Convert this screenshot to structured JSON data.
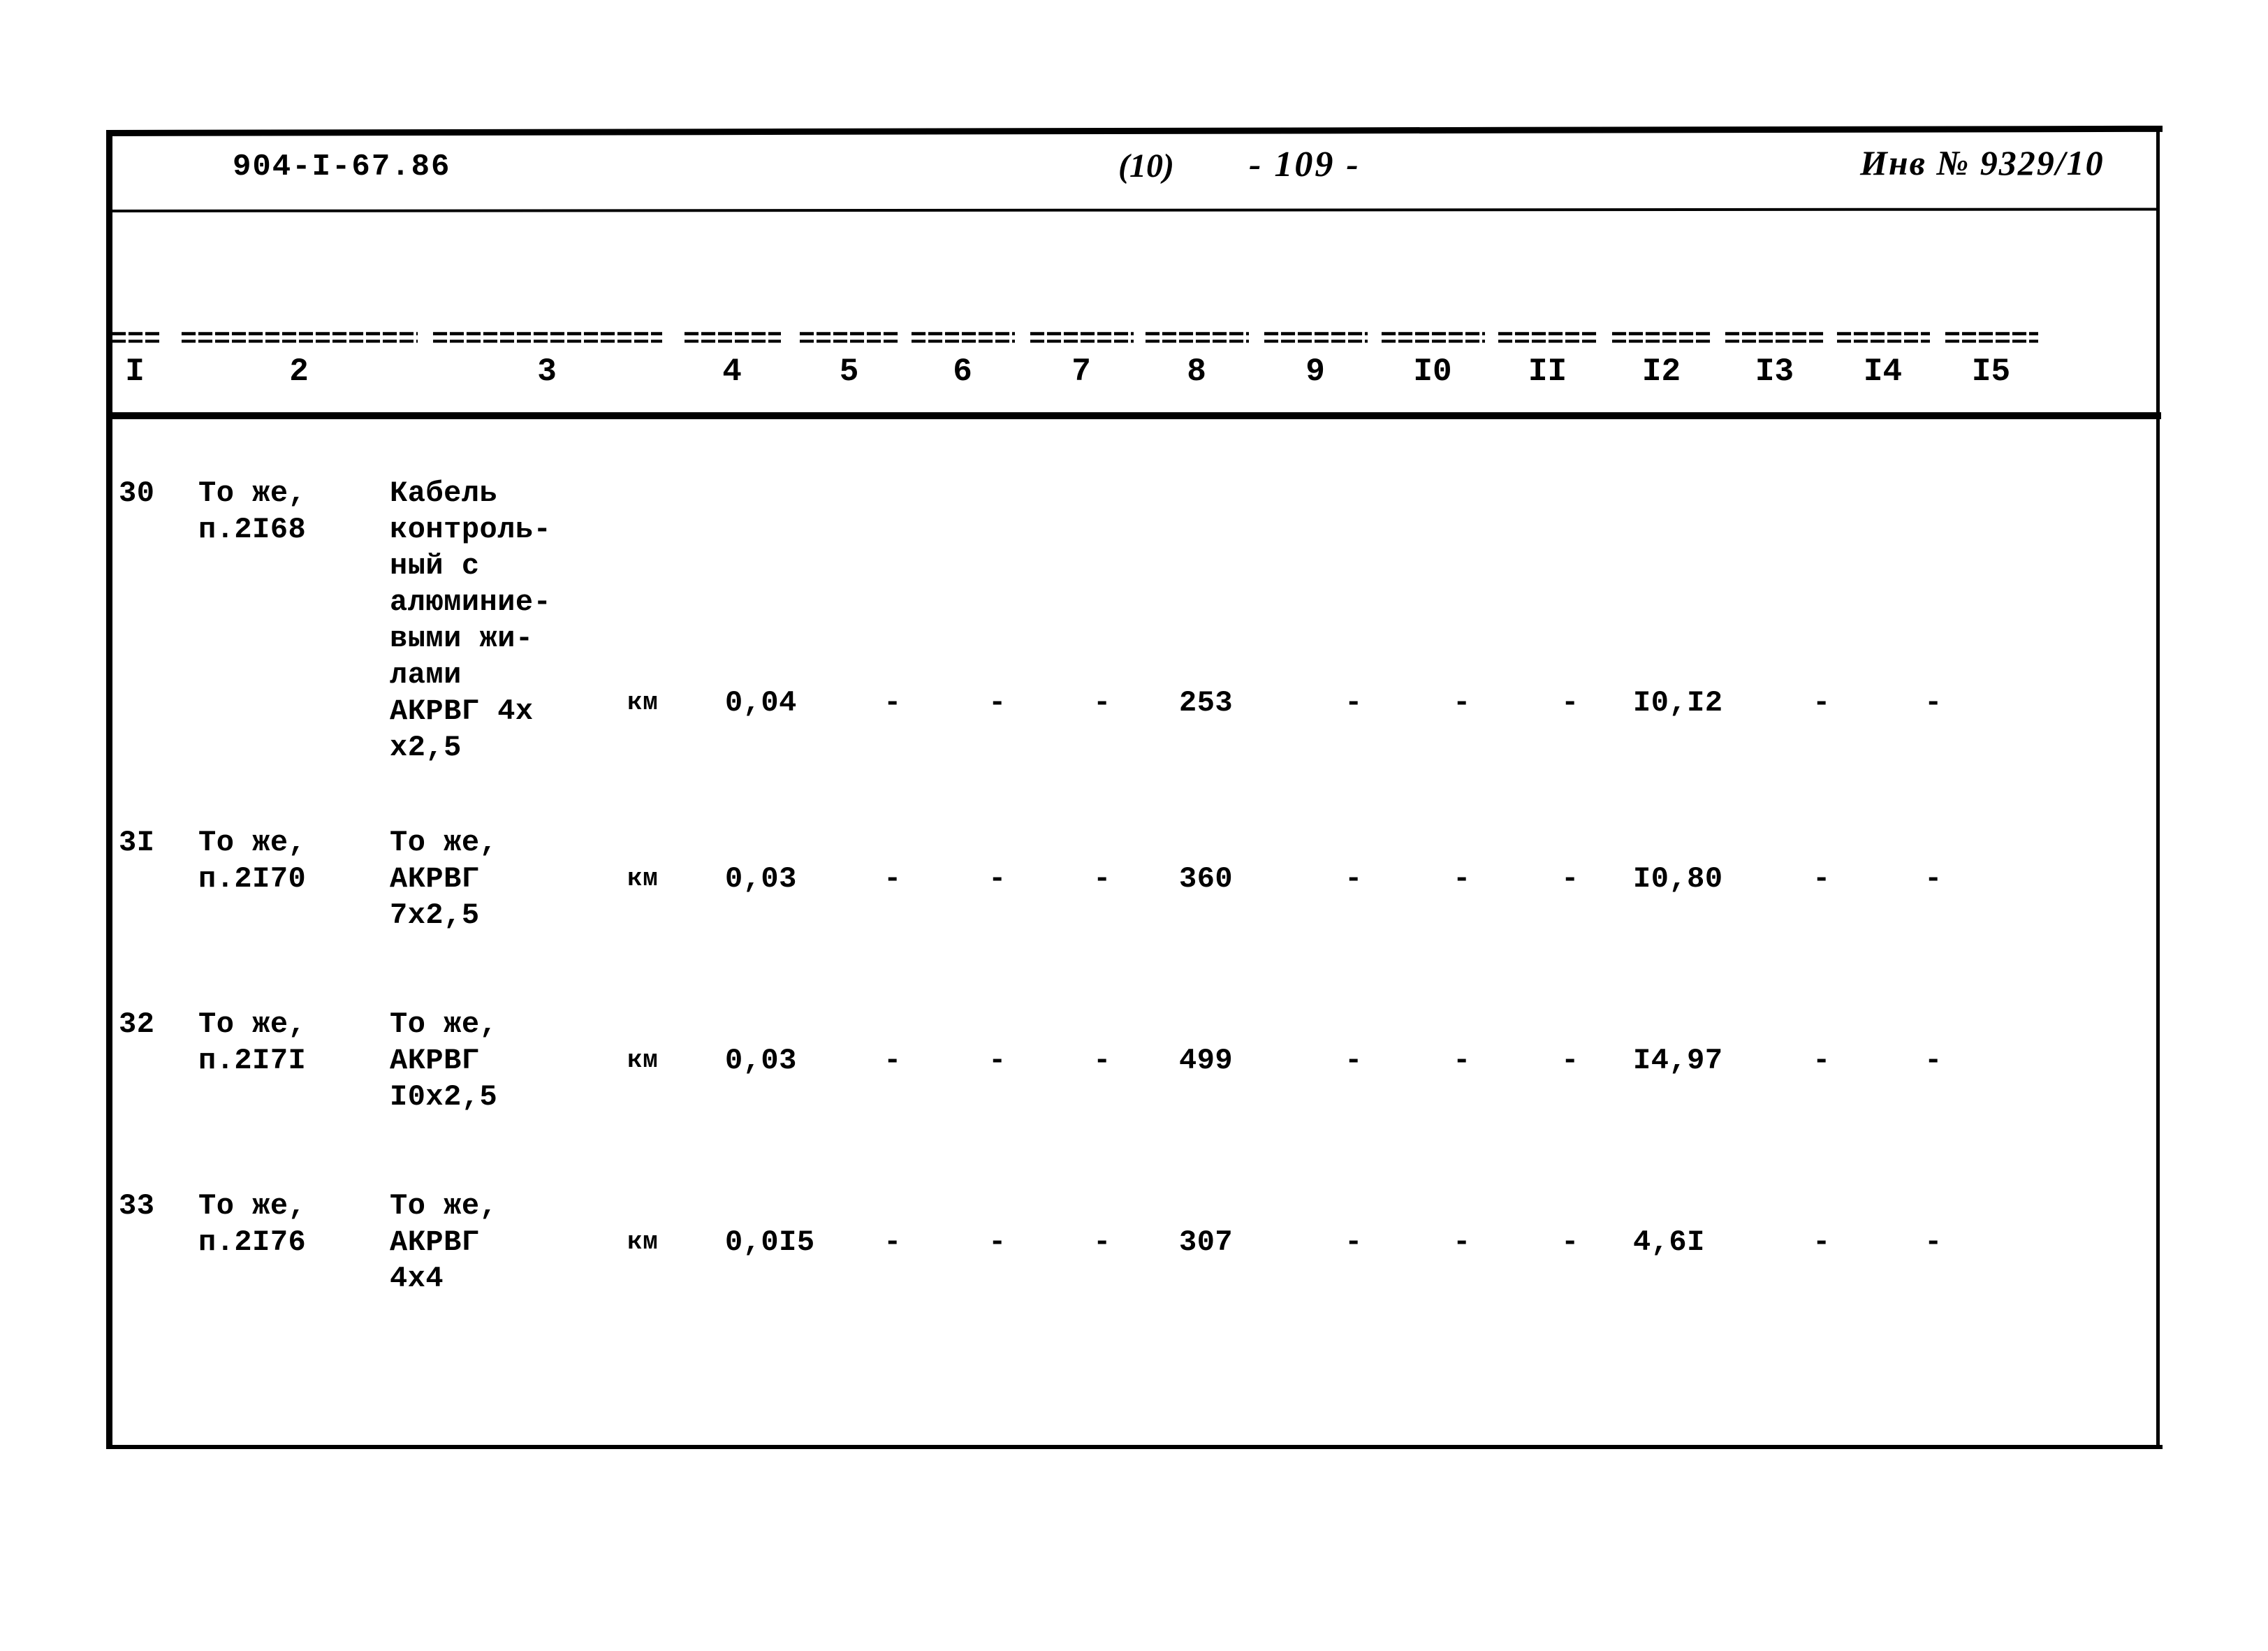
{
  "header": {
    "doc_code": "904-I-67.86",
    "sheet_no_handwritten": "(10)",
    "page_no_handwritten": "- 109 -",
    "inventory_handwritten": "Инв № 9329/10"
  },
  "table": {
    "column_numbers": [
      "I",
      "2",
      "3",
      "4",
      "5",
      "6",
      "7",
      "8",
      "9",
      "I0",
      "II",
      "I2",
      "I3",
      "I4",
      "I5"
    ],
    "separator_mark": "======================",
    "rows": [
      {
        "c1": "30",
        "c2": "То же,\nп.2I68",
        "c3": "Кабель\nконтроль-\nный с\nалюминие-\nвыми жи-\nлами\nАКРВГ 4х\nх2,5",
        "c4": "км",
        "c5": "0,04",
        "c6": "-",
        "c7": "-",
        "c8": "-",
        "c9": "253",
        "c10": "-",
        "c11": "-",
        "c12": "-",
        "c13": "I0,I2",
        "c14": "-",
        "c15": "-"
      },
      {
        "c1": "3I",
        "c2": "То же,\nп.2I70",
        "c3": "То же,\nАКРВГ\n7х2,5",
        "c4": "км",
        "c5": "0,03",
        "c6": "-",
        "c7": "-",
        "c8": "-",
        "c9": "360",
        "c10": "-",
        "c11": "-",
        "c12": "-",
        "c13": "I0,80",
        "c14": "-",
        "c15": "-"
      },
      {
        "c1": "32",
        "c2": "То же,\nп.2I7I",
        "c3": "То же,\nАКРВГ\nI0х2,5",
        "c4": "км",
        "c5": "0,03",
        "c6": "-",
        "c7": "-",
        "c8": "-",
        "c9": "499",
        "c10": "-",
        "c11": "-",
        "c12": "-",
        "c13": "I4,97",
        "c14": "-",
        "c15": "-"
      },
      {
        "c1": "33",
        "c2": "То же,\nп.2I76",
        "c3": "То же,\nАКРВГ\n4х4",
        "c4": "км",
        "c5": "0,0I5",
        "c6": "-",
        "c7": "-",
        "c8": "-",
        "c9": "307",
        "c10": "-",
        "c11": "-",
        "c12": "-",
        "c13": "4,6I",
        "c14": "-",
        "c15": "-"
      }
    ]
  }
}
